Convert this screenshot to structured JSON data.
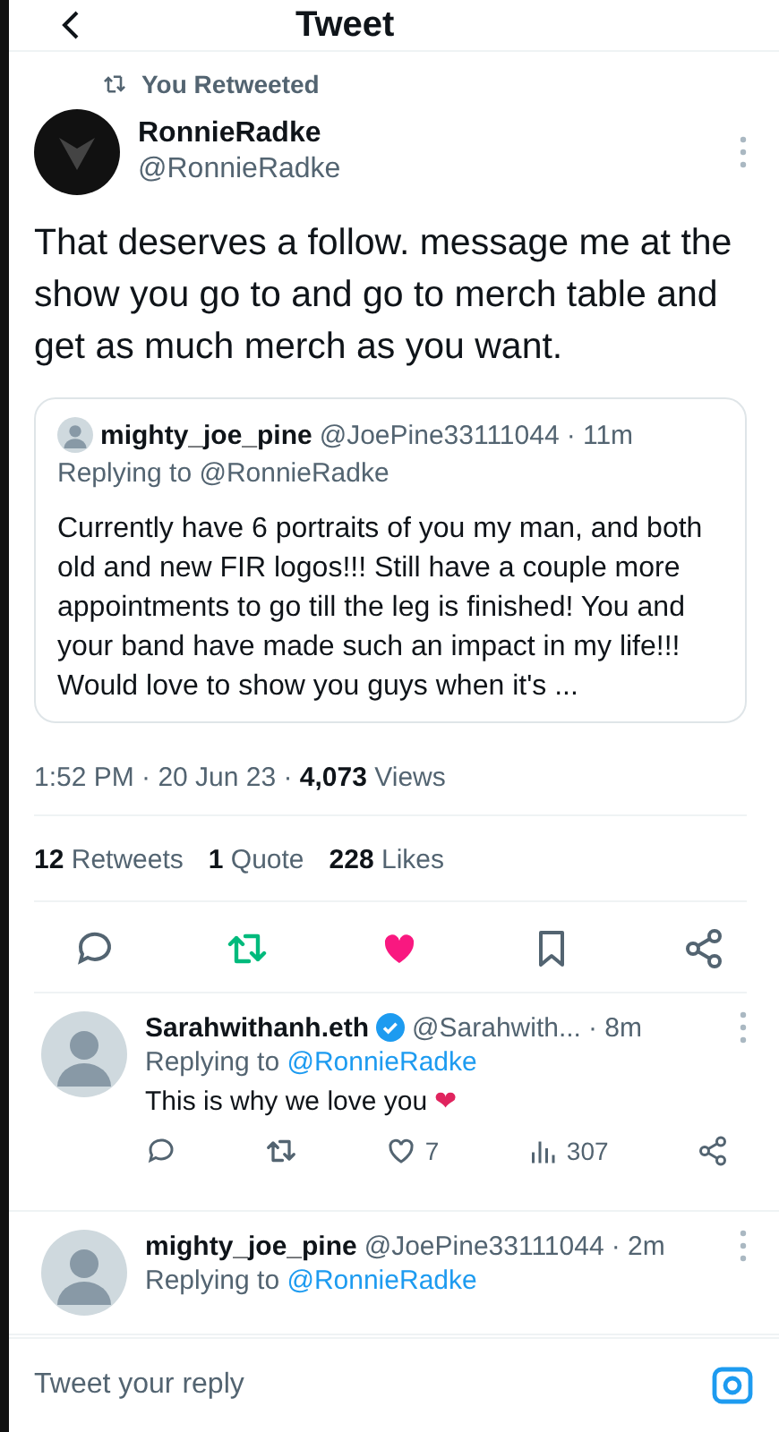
{
  "header": {
    "title": "Tweet"
  },
  "tweet": {
    "retweet_note": "You Retweeted",
    "author": {
      "name": "RonnieRadke",
      "handle": "@RonnieRadke"
    },
    "text": "That deserves a follow. message me at the show you go to and go to merch table and get as much merch as you want.",
    "quote": {
      "name": "mighty_joe_pine",
      "handle": "@JoePine33111044",
      "time": "· 11m",
      "replying_to": "Replying to @RonnieRadke",
      "text": "Currently have 6 portraits of you my man, and both old and new FIR logos!!! Still have a couple more appointments to go till the leg is finished! You and your band have made such an impact in my life!!! Would love to show you guys when it's ..."
    },
    "meta": "1:52 PM · 20 Jun 23 · **4,073** Views",
    "stats": [
      {
        "count": "12",
        "label": "Retweets"
      },
      {
        "count": "1",
        "label": "Quote"
      },
      {
        "count": "228",
        "label": "Likes"
      }
    ],
    "actions": [
      {
        "kind": "reply"
      },
      {
        "kind": "retweet",
        "on": true
      },
      {
        "kind": "like",
        "on": true
      },
      {
        "kind": "bookmark",
        "on": false
      },
      {
        "kind": "share"
      }
    ]
  },
  "replies": [
    {
      "name": "Sarahwithanh.eth",
      "verified": true,
      "handle": "@Sarahwith...",
      "time": "· 8m",
      "replying_label": "Replying to",
      "replying_handle": "@RonnieRadke",
      "text": "This is why we love you",
      "emoji": "❤",
      "actions": [
        {
          "kind": "reply"
        },
        {
          "kind": "retweet",
          "on": false
        },
        {
          "kind": "like",
          "on": false,
          "count": "7"
        },
        {
          "kind": "views",
          "count": "307"
        },
        {
          "kind": "share"
        }
      ]
    },
    {
      "name": "mighty_joe_pine",
      "verified": false,
      "handle": "@JoePine33111044",
      "time": "· 2m",
      "replying_label": "Replying to",
      "replying_handle": "@RonnieRadke"
    }
  ],
  "composer": {
    "placeholder": "Tweet your reply"
  }
}
